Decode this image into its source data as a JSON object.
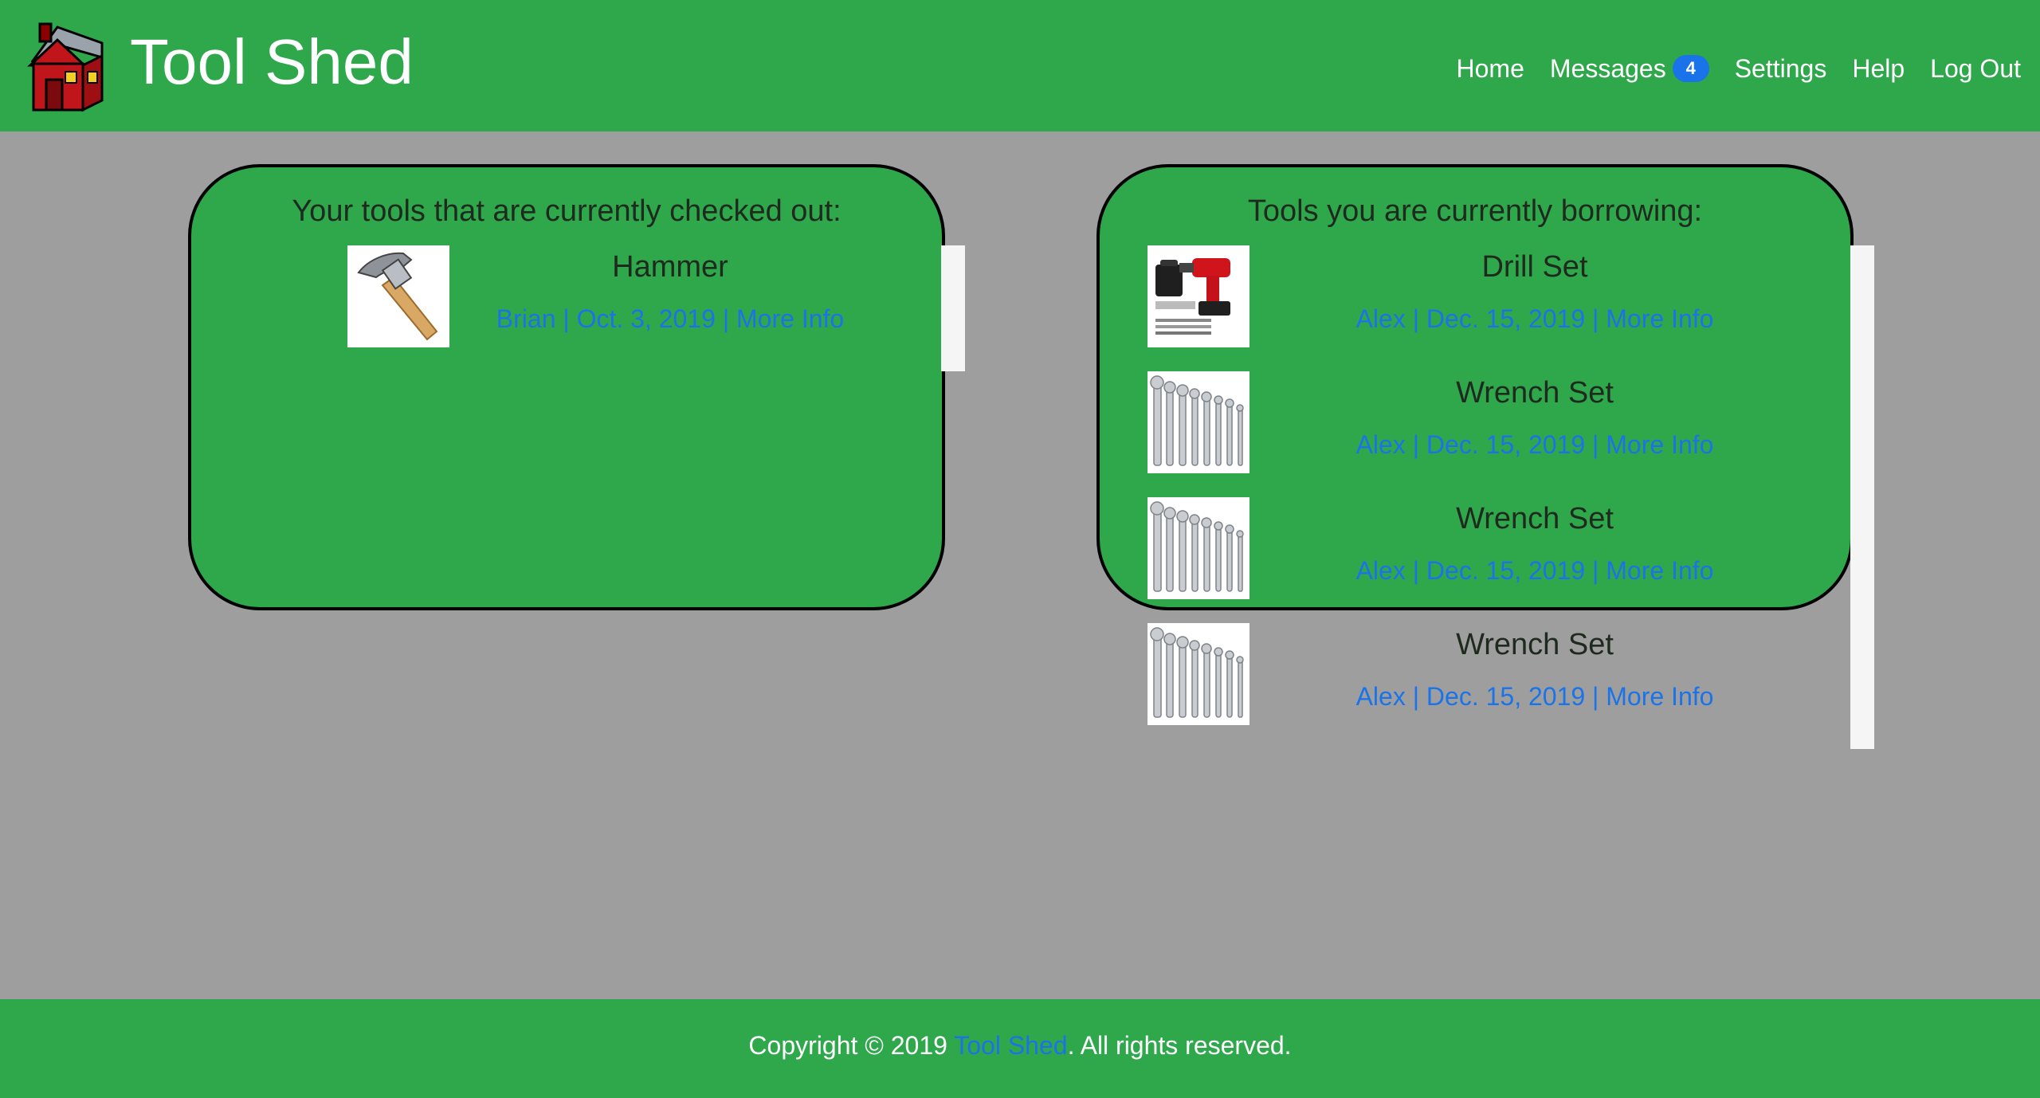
{
  "header": {
    "title": "Tool Shed",
    "logo": "red-house-icon",
    "nav": {
      "home": "Home",
      "messages": "Messages",
      "messages_count": "4",
      "settings": "Settings",
      "help": "Help",
      "logout": "Log Out"
    }
  },
  "checked_out": {
    "heading": "Your tools that are currently checked out:",
    "items": [
      {
        "name": "Hammer",
        "person": "Brian",
        "date": "Oct. 3, 2019",
        "link": "More Info",
        "icon": "hammer-icon"
      }
    ]
  },
  "borrowing": {
    "heading": "Tools you are currently borrowing:",
    "items": [
      {
        "name": "Drill Set",
        "person": "Alex",
        "date": "Dec. 15, 2019",
        "link": "More Info",
        "icon": "drill-icon"
      },
      {
        "name": "Wrench Set",
        "person": "Alex",
        "date": "Dec. 15, 2019",
        "link": "More Info",
        "icon": "wrench-set-icon"
      },
      {
        "name": "Wrench Set",
        "person": "Alex",
        "date": "Dec. 15, 2019",
        "link": "More Info",
        "icon": "wrench-set-icon"
      },
      {
        "name": "Wrench Set",
        "person": "Alex",
        "date": "Dec. 15, 2019",
        "link": "More Info",
        "icon": "wrench-set-icon"
      }
    ]
  },
  "footer": {
    "prefix": "Copyright © 2019 ",
    "link": "Tool Shed",
    "suffix": ". All rights reserved."
  },
  "colors": {
    "accent_green": "#2fa84c",
    "background_gray": "#9e9e9e",
    "link_blue": "#1a73e8"
  }
}
